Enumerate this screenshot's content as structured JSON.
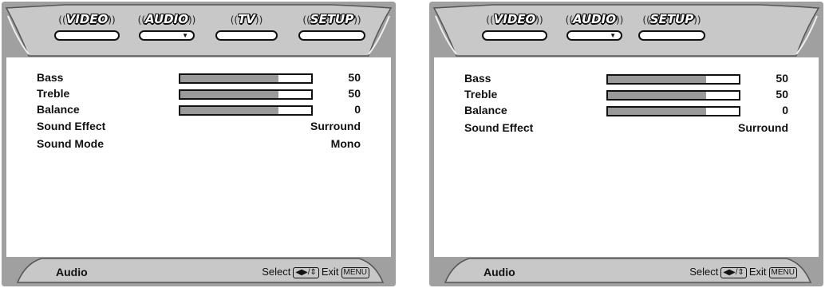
{
  "colors": {
    "frame": "#9e9e9e",
    "bar_fill": "#9a9a9a",
    "text": "#111111"
  },
  "screens": [
    {
      "tabs": [
        {
          "label": "VIDEO",
          "name": "tab-video",
          "has_arrow": false
        },
        {
          "label": "AUDIO",
          "name": "tab-audio",
          "has_arrow": true
        },
        {
          "label": "TV",
          "name": "tab-tv",
          "has_arrow": false
        },
        {
          "label": "SETUP",
          "name": "tab-setup",
          "has_arrow": false
        }
      ],
      "rows": [
        {
          "label": "Bass",
          "value": "50",
          "level": 0.75
        },
        {
          "label": "Treble",
          "value": "50",
          "level": 0.75
        },
        {
          "label": "Balance",
          "value": "0",
          "level": 0.75
        },
        {
          "label": "Sound Effect",
          "value": "Surround"
        },
        {
          "label": "Sound Mode",
          "value": "Mono"
        }
      ],
      "footer": {
        "title": "Audio",
        "select_label": "Select",
        "select_keys": "◀▶/⇕",
        "exit_label": "Exit",
        "exit_key": "MENU"
      }
    },
    {
      "tabs": [
        {
          "label": "VIDEO",
          "name": "tab-video",
          "has_arrow": false
        },
        {
          "label": "AUDIO",
          "name": "tab-audio",
          "has_arrow": true
        },
        {
          "label": "SETUP",
          "name": "tab-setup",
          "has_arrow": false
        }
      ],
      "rows": [
        {
          "label": "Bass",
          "value": "50",
          "level": 0.75
        },
        {
          "label": "Treble",
          "value": "50",
          "level": 0.75
        },
        {
          "label": "Balance",
          "value": "0",
          "level": 0.75
        },
        {
          "label": "Sound Effect",
          "value": "Surround"
        }
      ],
      "footer": {
        "title": "Audio",
        "select_label": "Select",
        "select_keys": "◀▶/⇕",
        "exit_label": "Exit",
        "exit_key": "MENU"
      }
    }
  ]
}
